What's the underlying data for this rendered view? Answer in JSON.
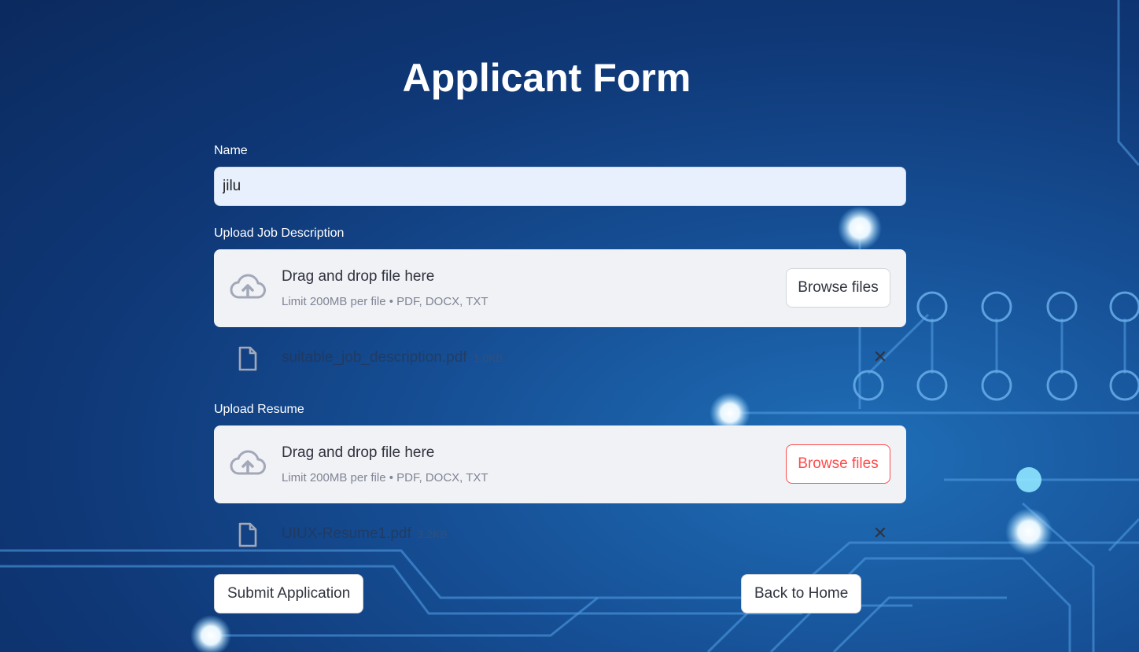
{
  "page": {
    "title": "Applicant Form"
  },
  "name_field": {
    "label": "Name",
    "value": "jilu"
  },
  "job_upload": {
    "label": "Upload Job Description",
    "drop_title": "Drag and drop file here",
    "drop_sub": "Limit 200MB per file • PDF, DOCX, TXT",
    "browse_label": "Browse files",
    "file": {
      "name": "suitable_job_description.pdf",
      "size": "1.0KB"
    }
  },
  "resume_upload": {
    "label": "Upload Resume",
    "drop_title": "Drag and drop file here",
    "drop_sub": "Limit 200MB per file • PDF, DOCX, TXT",
    "browse_label": "Browse files",
    "file": {
      "name": "UIUX-Resume1.pdf",
      "size": "3.2KB"
    }
  },
  "actions": {
    "submit_label": "Submit Application",
    "back_label": "Back to Home"
  },
  "icons": {
    "upload": "cloud-upload-icon",
    "file": "file-icon",
    "remove": "close-icon"
  },
  "colors": {
    "accent": "#ff4b4b",
    "input_bg": "#e8f0fe",
    "dropzone_bg": "#f0f2f6"
  }
}
